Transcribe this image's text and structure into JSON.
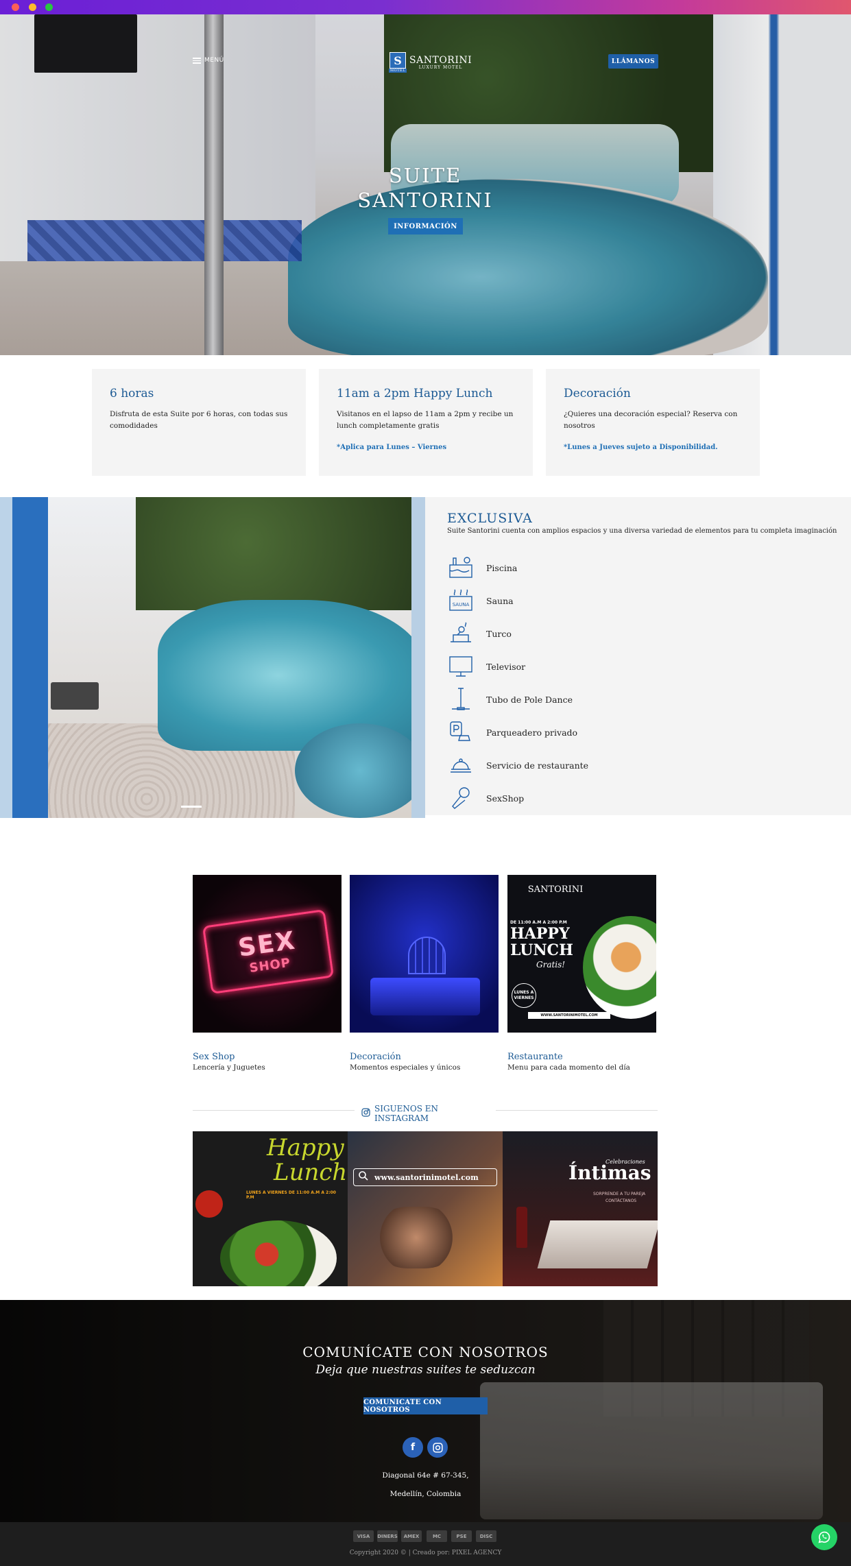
{
  "header": {
    "menu_label": "MENÚ",
    "logo_mark": "S",
    "logo_badge": "MOTEL",
    "logo_name": "SANTORINI",
    "logo_sub": "LUXURY MOTEL",
    "call_label": "LLÁMANOS"
  },
  "hero": {
    "title_line1": "SUITE",
    "title_line2": "SANTORINI",
    "info_button": "INFORMACIÓN"
  },
  "cards": [
    {
      "title": "6 horas",
      "text": "Disfruta de esta Suite por 6 horas, con todas sus comodidades",
      "note": ""
    },
    {
      "title": "11am a 2pm Happy Lunch",
      "text": "Visitanos en el lapso de 11am a 2pm y recibe un lunch completamente gratis",
      "note": "*Aplica para Lunes – Viernes"
    },
    {
      "title": "Decoración",
      "text": "¿Quieres una decoración especial? Reserva con nosotros",
      "note": "*Lunes a Jueves sujeto a Disponibilidad."
    }
  ],
  "exclusiva": {
    "title": "EXCLUSIVA",
    "description": "Suite Santorini cuenta con amplios espacios y una diversa variedad de elementos para tu completa imaginación",
    "amenities": [
      {
        "label": "Piscina",
        "icon": "pool-icon"
      },
      {
        "label": "Sauna",
        "icon": "sauna-icon"
      },
      {
        "label": "Turco",
        "icon": "steam-bath-icon"
      },
      {
        "label": "Televisor",
        "icon": "tv-icon"
      },
      {
        "label": "Tubo de Pole Dance",
        "icon": "pole-dance-icon"
      },
      {
        "label": "Parqueadero privado",
        "icon": "parking-icon"
      },
      {
        "label": "Servicio de restaurante",
        "icon": "restaurant-icon"
      },
      {
        "label": "SexShop",
        "icon": "microphone-icon"
      }
    ]
  },
  "promos": [
    {
      "title": "Sex Shop",
      "subtitle": "Lencería y Juguetes",
      "image_text_1": "SEX",
      "image_text_2": "SHOP"
    },
    {
      "title": "Decoración",
      "subtitle": "Momentos especiales y únicos"
    },
    {
      "title": "Restaurante",
      "subtitle": "Menu para cada momento del día",
      "image_text_1": "SANTORINI",
      "image_text_2": "HAPPY LUNCH",
      "image_text_3": "Gratis!",
      "image_text_4": "DE 11:00 A.M A 2:00 P.M",
      "image_text_5": "LUNES A VIERNES",
      "image_text_6": "WWW.SANTORINIMOTEL.COM"
    }
  ],
  "instagram": {
    "heading": "SIGUENOS EN INSTAGRAM",
    "posts": [
      {
        "text_1": "Happy",
        "text_2": "Lunch",
        "text_3": "LUNES A VIERNES DE 11:00 A.M A 2:00 P.M"
      },
      {
        "text_1": "www.santorinimotel.com"
      },
      {
        "text_1": "Celebraciones",
        "text_2": "Íntimas",
        "text_3": "SORPRENDE A TU PAREJA",
        "text_4": "CONTÁCTANOS"
      }
    ]
  },
  "contact": {
    "title": "COMUNÍCATE CON NOSOTROS",
    "subtitle": "Deja que nuestras suites te seduzcan",
    "button": "COMUNICATE CON NOSOTROS",
    "address_1": "Diagonal 64e # 67-345,",
    "address_2": "Medellín, Colombia"
  },
  "footer": {
    "payments": [
      "VISA",
      "DINERS",
      "AMEX",
      "MC",
      "PSE",
      "DISC"
    ],
    "copyright": "Copyright 2020 © | Creado por: PIXEL AGENCY"
  },
  "colors": {
    "primary": "#1c5a94",
    "button": "#1f5fa8",
    "whatsapp": "#25d366"
  }
}
